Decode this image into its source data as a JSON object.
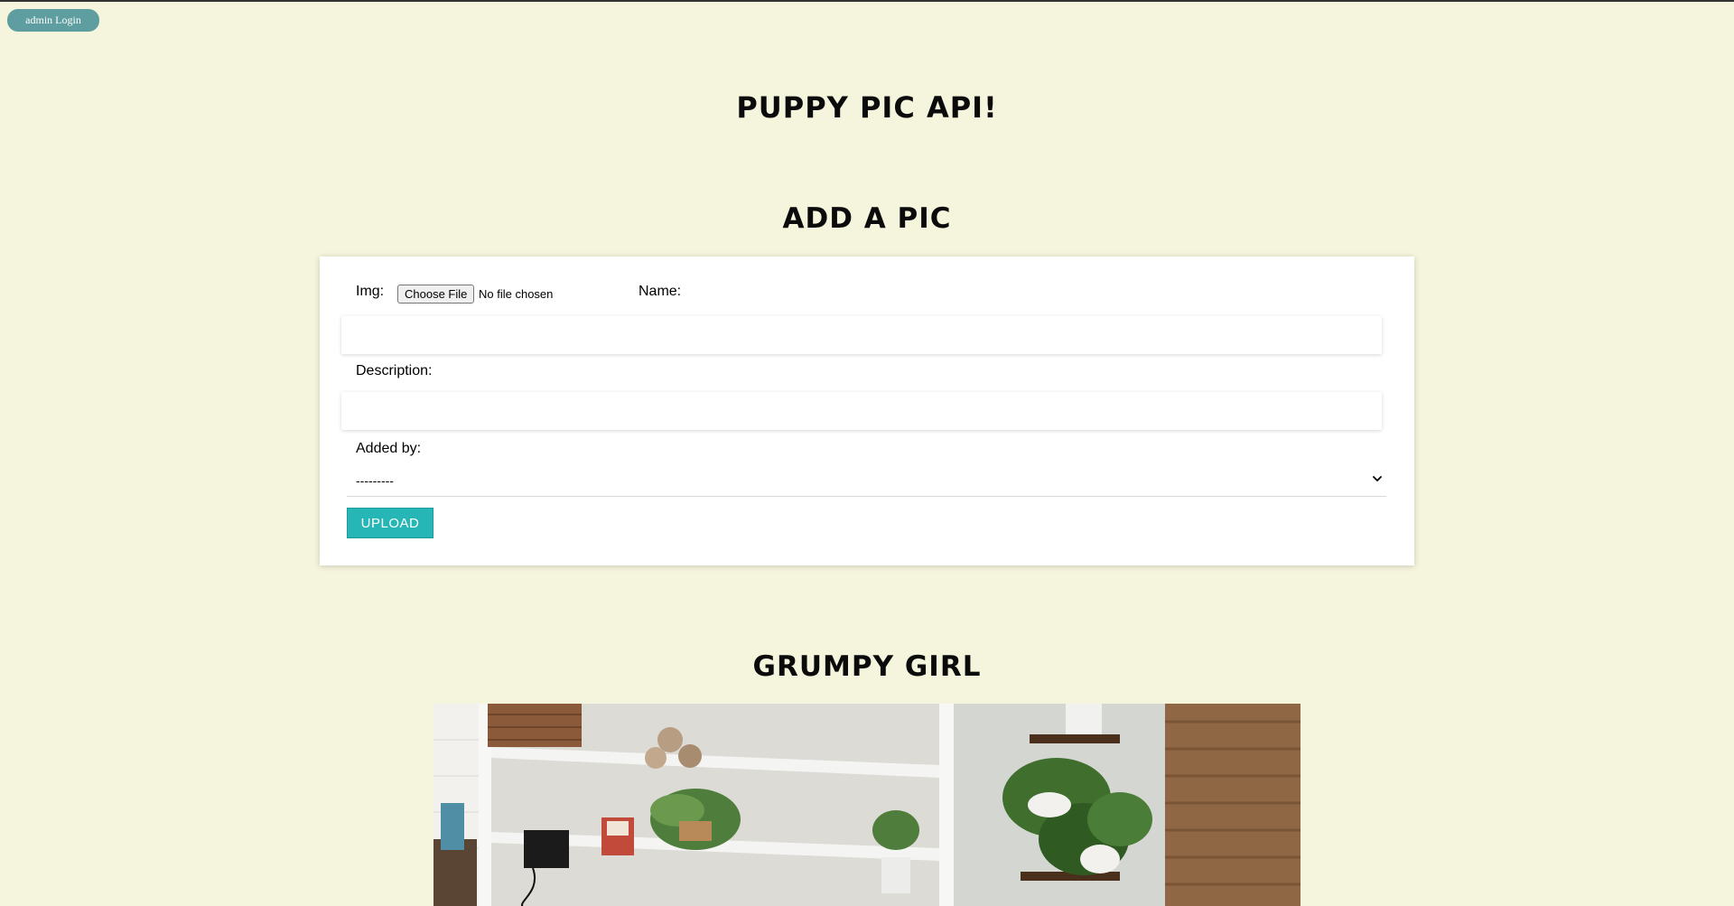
{
  "header": {
    "admin_login": "admin Login"
  },
  "site_title": "Puppy Pic API!",
  "add_form": {
    "title": "Add a Pic",
    "img_label": "Img:",
    "file_button": "Choose File",
    "file_status": "No file chosen",
    "name_label": "Name:",
    "name_value": "",
    "description_label": "Description:",
    "description_value": "",
    "added_by_label": "Added by:",
    "added_by_selected": "---------",
    "upload_button": "UPLOAD"
  },
  "pictures": [
    {
      "title": "Grumpy Girl"
    }
  ],
  "colors": {
    "background": "#f5f4dc",
    "admin_button": "#5f9ea0",
    "upload_button": "#26b6b6"
  }
}
